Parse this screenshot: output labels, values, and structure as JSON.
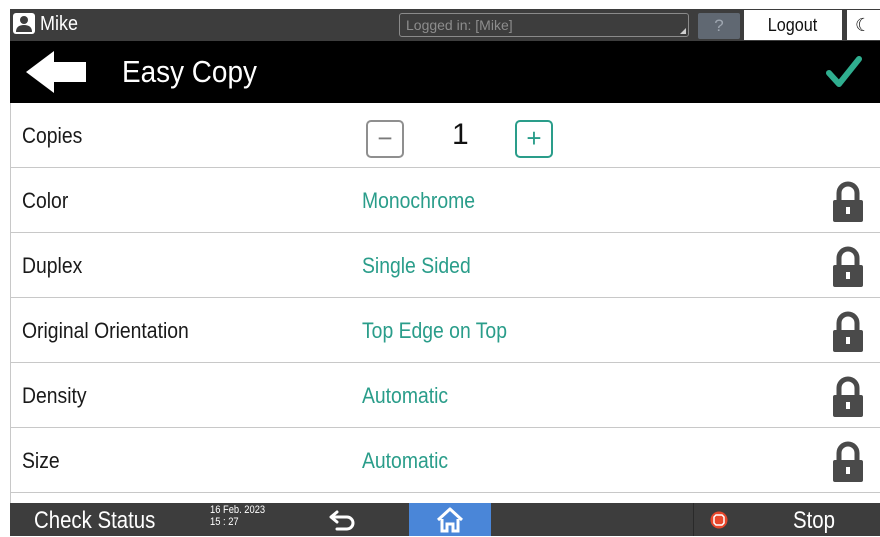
{
  "status_bar": {
    "user_name": "Mike",
    "login_placeholder": "Logged in: [Mike]",
    "help_label": "?",
    "logout_label": "Logout",
    "moon_glyph": "☾"
  },
  "header": {
    "title": "Easy Copy"
  },
  "copies": {
    "label": "Copies",
    "value": "1",
    "minus": "−",
    "plus": "+"
  },
  "settings": [
    {
      "label": "Color",
      "value": "Monochrome",
      "locked": true
    },
    {
      "label": "Duplex",
      "value": "Single Sided",
      "locked": true
    },
    {
      "label": "Original Orientation",
      "value": "Top Edge on Top",
      "locked": true
    },
    {
      "label": "Density",
      "value": "Automatic",
      "locked": true
    },
    {
      "label": "Size",
      "value": "Automatic",
      "locked": true
    }
  ],
  "bottom_bar": {
    "check_status": "Check Status",
    "date": "16 Feb. 2023",
    "time": "15 : 27",
    "stop_label": "Stop"
  },
  "colors": {
    "accent": "#2a9d8a",
    "header_bg": "#000000",
    "bar_bg": "#3d3d3d",
    "home_bg": "#4a86d8",
    "stop_red": "#e8472b"
  },
  "icons": [
    "user-icon",
    "back-arrow-icon",
    "checkmark-icon",
    "lock-icon",
    "return-icon",
    "home-icon",
    "stop-icon",
    "moon-icon",
    "help-icon"
  ]
}
